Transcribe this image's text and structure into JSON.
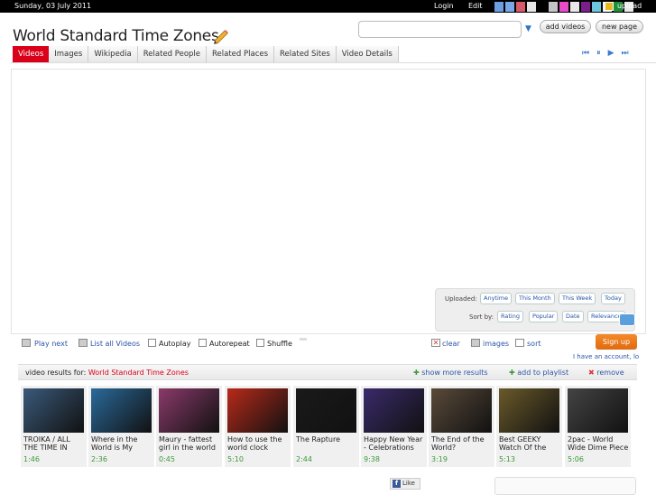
{
  "topbar": {
    "date": "Sunday, 03 July 2011",
    "login": "Login",
    "edit": "Edit",
    "upload": "upload",
    "swatches": [
      "#6d9ee0",
      "#7aa7e8",
      "#d85a68",
      "#e6e6e6",
      "#000000",
      "#c5c5c5",
      "#e84bc9",
      "#e8e8e8",
      "#7a1f8c",
      "#6cc6dc",
      "#f2f2f2",
      "#1e8c3a",
      "#e8e8e8"
    ]
  },
  "header": {
    "title": "World Standard Time Zones",
    "search_placeholder": "",
    "add_videos": "add videos",
    "new_page": "new page"
  },
  "tabs": [
    {
      "label": "Videos",
      "active": true
    },
    {
      "label": "Images"
    },
    {
      "label": "Wikipedia"
    },
    {
      "label": "Related People"
    },
    {
      "label": "Related Places"
    },
    {
      "label": "Related Sites"
    },
    {
      "label": "Video Details"
    }
  ],
  "nav_controls": [
    "⏮",
    "⏸",
    "▶",
    "⏭"
  ],
  "filters": {
    "uploaded_label": "Uploaded:",
    "uploaded": [
      "Anytime",
      "This Month",
      "This Week",
      "Today"
    ],
    "sort_label": "Sort by:",
    "sort": [
      "Rating",
      "Popular",
      "Date",
      "Relevance"
    ]
  },
  "controls": {
    "play_next": "Play next",
    "list_all": "List all Videos",
    "autoplay": "Autoplay",
    "autorepeat": "Autorepeat",
    "shuffle": "Shuffle",
    "clear": "clear",
    "images": "images",
    "sort": "sort",
    "signup": "Sign up",
    "account": "I have an account, lo"
  },
  "results": {
    "label": "video results for:",
    "query": "World Standard Time Zones",
    "show_more": "show more results",
    "add_playlist": "add to playlist",
    "remove": "remove"
  },
  "videos": [
    {
      "title": "TROIKA / ALL THE TIME IN",
      "duration": "1:46",
      "color": "#3a5a7a"
    },
    {
      "title": "Where in the World is My",
      "duration": "2:36",
      "color": "#2a6a9a"
    },
    {
      "title": "Maury - fattest girl in the world",
      "duration": "0:45",
      "color": "#8a3a6a"
    },
    {
      "title": "How to use the world clock",
      "duration": "5:10",
      "color": "#b82a1a"
    },
    {
      "title": "The Rapture",
      "duration": "2:44",
      "color": "#1a1a1a"
    },
    {
      "title": "Happy New Year - Celebrations",
      "duration": "9:38",
      "color": "#3a2a6a"
    },
    {
      "title": "The End of the World?",
      "duration": "3:19",
      "color": "#5a4a3a"
    },
    {
      "title": "Best GEEKY Watch Of the",
      "duration": "5:13",
      "color": "#6a5a2a"
    },
    {
      "title": "2pac - World Wide Dime Piece",
      "duration": "5:06",
      "color": "#444444"
    }
  ],
  "like": "Like"
}
